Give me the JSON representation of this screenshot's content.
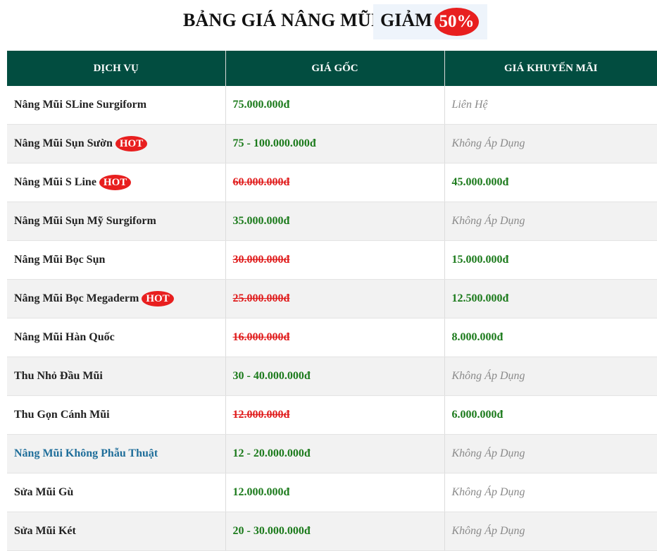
{
  "header": {
    "title": "BẢNG GIÁ NÂNG MŨI",
    "promo_text": "GIẢM",
    "promo_badge": "50%"
  },
  "columns": [
    "DỊCH VỤ",
    "GIÁ GỐC",
    "GIÁ KHUYẾN MÃI"
  ],
  "rows": [
    {
      "service": "Nâng Mũi SLine Surgiform",
      "hot": false,
      "original": "75.000.000đ",
      "original_struck": false,
      "promo": "Liên Hệ",
      "promo_available": false
    },
    {
      "service": "Nâng Mũi Sụn Sườn",
      "hot": true,
      "original": "75 - 100.000.000đ",
      "original_struck": false,
      "promo": "Không Áp Dụng",
      "promo_available": false
    },
    {
      "service": "Nâng Mũi S Line",
      "hot": true,
      "original": "60.000.000đ",
      "original_struck": true,
      "promo": "45.000.000đ",
      "promo_available": true
    },
    {
      "service": "Nâng Mũi Sụn Mỹ Surgiform",
      "hot": false,
      "original": "35.000.000đ",
      "original_struck": false,
      "promo": "Không Áp Dụng",
      "promo_available": false
    },
    {
      "service": "Nâng Mũi Bọc Sụn",
      "hot": false,
      "original": "30.000.000đ",
      "original_struck": true,
      "promo": "15.000.000đ",
      "promo_available": true
    },
    {
      "service": "Nâng Mũi Bọc Megaderm",
      "hot": true,
      "original": "25.000.000đ",
      "original_struck": true,
      "promo": "12.500.000đ",
      "promo_available": true
    },
    {
      "service": "Nâng Mũi Hàn Quốc",
      "hot": false,
      "original": "16.000.000đ",
      "original_struck": true,
      "promo": "8.000.000đ",
      "promo_available": true
    },
    {
      "service": "Thu Nhỏ Đầu Mũi",
      "hot": false,
      "original": "30 - 40.000.000đ",
      "original_struck": false,
      "promo": "Không Áp Dụng",
      "promo_available": false
    },
    {
      "service": "Thu Gọn Cánh Mũi",
      "hot": false,
      "original": "12.000.000đ",
      "original_struck": true,
      "promo": "6.000.000đ",
      "promo_available": true
    },
    {
      "service": "Nâng Mũi Không Phẫu Thuật",
      "hot": false,
      "link": true,
      "original": "12 - 20.000.000đ",
      "original_struck": false,
      "promo": "Không Áp Dụng",
      "promo_available": false
    },
    {
      "service": "Sửa Mũi Gù",
      "hot": false,
      "original": "12.000.000đ",
      "original_struck": false,
      "promo": "Không Áp Dụng",
      "promo_available": false
    },
    {
      "service": "Sửa Mũi Két",
      "hot": false,
      "original": "20 - 30.000.000đ",
      "original_struck": false,
      "promo": "Không Áp Dụng",
      "promo_available": false
    }
  ],
  "hot_label": "HOT",
  "colors": {
    "header_bg": "#024d40",
    "price_green": "#1b7a1b",
    "strike_red": "#e01b1b",
    "badge_red": "#e81f1f",
    "link_blue": "#1f6e9a"
  }
}
